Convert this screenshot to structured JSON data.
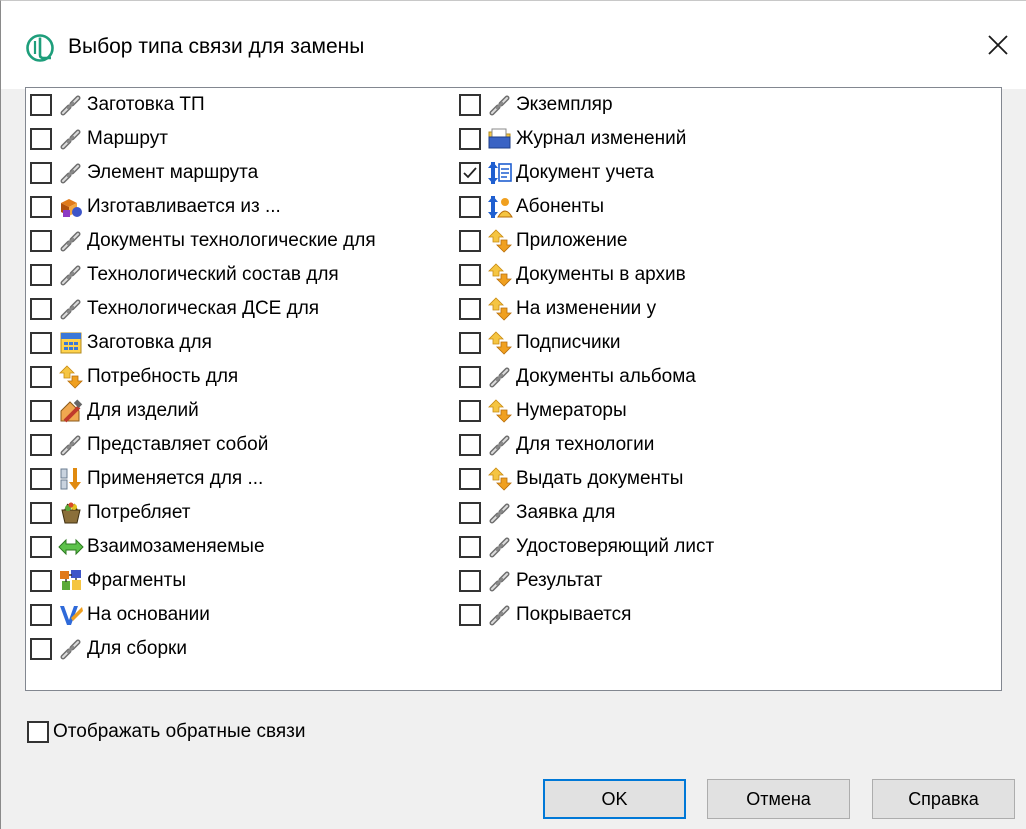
{
  "dialog": {
    "title": "Выбор типа связи для замены"
  },
  "list": {
    "column1": [
      {
        "label": "Заготовка ТП",
        "icon": "chain-link-icon",
        "checked": false
      },
      {
        "label": "Маршрут",
        "icon": "chain-link-icon",
        "checked": false
      },
      {
        "label": "Элемент маршрута",
        "icon": "chain-link-icon",
        "checked": false
      },
      {
        "label": "Изготавливается из ...",
        "icon": "material-shapes-icon",
        "checked": false
      },
      {
        "label": "Документы технологические для",
        "icon": "chain-link-icon",
        "checked": false
      },
      {
        "label": "Технологический состав для",
        "icon": "chain-link-icon",
        "checked": false
      },
      {
        "label": "Технологическая ДСЕ для",
        "icon": "chain-link-icon",
        "checked": false
      },
      {
        "label": "Заготовка для",
        "icon": "calculator-icon",
        "checked": false
      },
      {
        "label": "Потребность для",
        "icon": "yellow-arrows-icon",
        "checked": false
      },
      {
        "label": "Для изделий",
        "icon": "hammer-house-icon",
        "checked": false
      },
      {
        "label": "Представляет собой",
        "icon": "chain-link-icon",
        "checked": false
      },
      {
        "label": "Применяется для ...",
        "icon": "down-arrow-icon",
        "checked": false
      },
      {
        "label": "Потребляет",
        "icon": "basket-icon",
        "checked": false
      },
      {
        "label": "Взаимозаменяемые",
        "icon": "double-arrow-icon",
        "checked": false
      },
      {
        "label": "Фрагменты",
        "icon": "fragments-icon",
        "checked": false
      },
      {
        "label": "На основании",
        "icon": "blue-document-icon",
        "checked": false
      },
      {
        "label": "Для сборки",
        "icon": "chain-link-icon",
        "checked": false
      }
    ],
    "column2": [
      {
        "label": "Экземпляр",
        "icon": "chain-link-icon",
        "checked": false
      },
      {
        "label": "Журнал изменений",
        "icon": "folder-icon",
        "checked": false
      },
      {
        "label": "Документ учета",
        "icon": "document-accounting-icon",
        "checked": true
      },
      {
        "label": "Абоненты",
        "icon": "subscribers-icon",
        "checked": false
      },
      {
        "label": "Приложение",
        "icon": "yellow-arrows-icon",
        "checked": false
      },
      {
        "label": "Документы в архив",
        "icon": "yellow-arrows-icon",
        "checked": false
      },
      {
        "label": "На изменении у",
        "icon": "yellow-arrows-icon",
        "checked": false
      },
      {
        "label": "Подписчики",
        "icon": "yellow-arrows-icon",
        "checked": false
      },
      {
        "label": "Документы альбома",
        "icon": "chain-link-icon",
        "checked": false
      },
      {
        "label": "Нумераторы",
        "icon": "yellow-arrows-icon",
        "checked": false
      },
      {
        "label": "Для технологии",
        "icon": "chain-link-icon",
        "checked": false
      },
      {
        "label": "Выдать документы",
        "icon": "yellow-arrows-icon",
        "checked": false
      },
      {
        "label": "Заявка для",
        "icon": "chain-link-icon",
        "checked": false
      },
      {
        "label": "Удостоверяющий лист",
        "icon": "chain-link-icon",
        "checked": false
      },
      {
        "label": "Результат",
        "icon": "chain-link-icon",
        "checked": false
      },
      {
        "label": "Покрывается",
        "icon": "chain-link-icon",
        "checked": false
      }
    ]
  },
  "options": {
    "show_reverse_label": "Отображать обратные связи",
    "show_reverse_checked": false
  },
  "buttons": {
    "ok": "OK",
    "cancel": "Отмена",
    "help": "Справка"
  }
}
